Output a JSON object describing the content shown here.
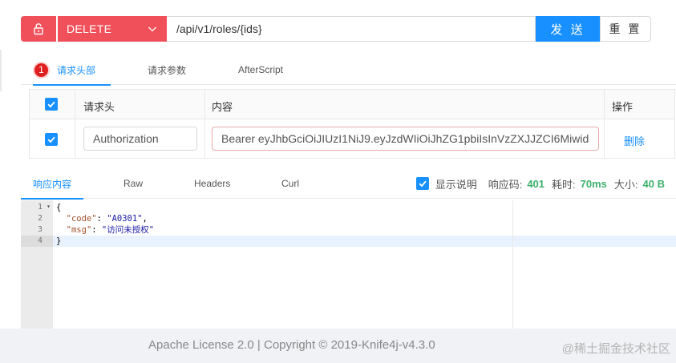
{
  "request": {
    "method": "DELETE",
    "url": "/api/v1/roles/{ids}",
    "send_label": "发 送",
    "reset_label": "重 置"
  },
  "request_tabs": [
    {
      "label": "请求头部",
      "badge": "1",
      "active": true
    },
    {
      "label": "请求参数",
      "active": false
    },
    {
      "label": "AfterScript",
      "active": false
    }
  ],
  "headers_table": {
    "columns": [
      "请求头",
      "内容",
      "操作"
    ],
    "rows": [
      {
        "checked": true,
        "name": "Authorization",
        "value": "Bearer eyJhbGciOiJIUzI1NiJ9.eyJzdWIiOiJhZG1pbiIsInVzZXJJZCI6Miwid",
        "action": "删除"
      }
    ]
  },
  "response_tabs": [
    {
      "label": "响应内容",
      "active": true
    },
    {
      "label": "Raw",
      "active": false
    },
    {
      "label": "Headers",
      "active": false
    },
    {
      "label": "Curl",
      "active": false
    }
  ],
  "response_meta": {
    "show_desc_label": "显示说明",
    "show_desc_checked": true,
    "code_label": "响应码:",
    "code_value": "401",
    "time_label": "耗时:",
    "time_value": "70ms",
    "size_label": "大小:",
    "size_value": "40 B"
  },
  "editor": {
    "line_numbers": [
      "1",
      "2",
      "3",
      "4"
    ],
    "lines": [
      {
        "text": "{"
      },
      {
        "key": "\"code\"",
        "value": "\"A0301\"",
        "trail": ","
      },
      {
        "key": "\"msg\"",
        "value": "\"访问未授权\"",
        "trail": ""
      },
      {
        "text": "}"
      }
    ],
    "active_line": 4
  },
  "footer": {
    "text": "Apache License 2.0 | Copyright © 2019-Knife4j-v4.3.0",
    "watermark": "@稀土掘金技术社区"
  },
  "colors": {
    "danger": "#f0505a",
    "primary": "#1890ff",
    "success": "#3bb06b"
  },
  "icons": {
    "lock": "unlock-icon",
    "method_dropdown": "chevron-down-icon"
  }
}
